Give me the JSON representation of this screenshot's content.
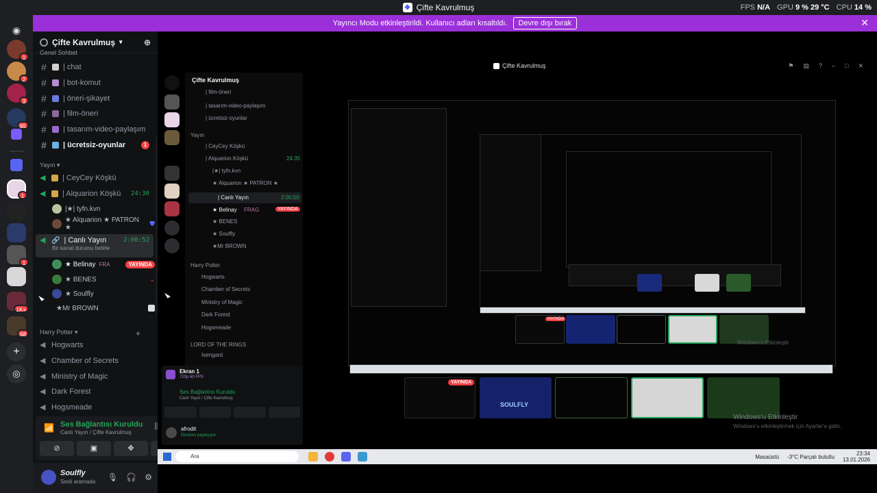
{
  "window": {
    "title": "Çifte Kavrulmuş",
    "hud": {
      "fps_label": "FPS",
      "fps_value": "N/A",
      "gpu_label": "GPU",
      "gpu_value": "9 %",
      "gpu_temp": "29 °C",
      "cpu_label": "CPU",
      "cpu_value": "14 %"
    }
  },
  "banner": {
    "text": "Yayıncı Modu etkinleştirildi. Kullanıcı adları kısaltıldı.",
    "button": "Devre dışı bırak",
    "close": "✕"
  },
  "rail": {
    "badges": [
      "1",
      "2",
      "3",
      "85",
      "1",
      "1",
      "1K+",
      "68"
    ]
  },
  "server": {
    "name": "Çifte Kavrulmuş",
    "partial_category": "Genel Sohbet",
    "channels": [
      {
        "name": "| chat"
      },
      {
        "name": "| bot-komut"
      },
      {
        "name": "| öneri-şikayet"
      },
      {
        "name": "| film-öneri"
      },
      {
        "name": "| tasarım-video-paylaşım"
      },
      {
        "name": "| ücretsiz-oyunlar",
        "count": "1"
      }
    ],
    "voice_category": "Yayın",
    "voice_channels": [
      {
        "name": "| CeyCey Köşkü"
      },
      {
        "name": "| Alquarion Köşkü",
        "timer": "24:30"
      },
      {
        "name": "| Canlı Yayın",
        "timer": "2:00:52",
        "status": "Bir kanal durumu belirle"
      }
    ],
    "alquarion_users": [
      "|★| tyfn.kvn",
      "★ Alquarion ★ PATRON ★"
    ],
    "live_users": [
      {
        "name": "★ Belinay",
        "tag": "FRA",
        "badge": "YAYINDA"
      },
      {
        "name": "★ BENES"
      },
      {
        "name": "★ Soulfly"
      },
      {
        "name": "★Mr BROWN"
      }
    ],
    "hp_category": "Harry Potter",
    "hp_channels": [
      "Hogwarts",
      "Chamber of Secrets",
      "Ministry of Magic",
      "Dark Forest",
      "Hogsmeade"
    ]
  },
  "voice_panel": {
    "title": "Ses Bağlantısı Kuruldu",
    "subtitle": "Canlı Yayın / Çifte Kavrulmuş"
  },
  "user_bar": {
    "name": "Soulfly",
    "status": "Sesli aramada"
  },
  "stream": {
    "window_title": "Çifte Kavrulmuş",
    "inner_channels": [
      "| film-öneri",
      "| tasarım-video-paylaşım",
      "| ücretsiz-oyunlar"
    ],
    "inner_category": "Yayın",
    "inner_voice": [
      "| CeyCey Köşkü",
      "| Alquarion Köşkü"
    ],
    "inner_timer": "24:35",
    "inner_users": [
      "|★| tyfn.kvn",
      "★ Alquarion ★ PATRON ★"
    ],
    "inner_live": "| Canlı Yayın",
    "inner_live_timer": "2:00:50",
    "inner_live_users": [
      "★ Belinay",
      "★ BENES",
      "★ Soulfly",
      "★Mr BROWN"
    ],
    "inner_badge": "YAYINDA",
    "inner_frag": "FRAG",
    "inner_hp": "Harry Potter",
    "inner_hp_channels": [
      "Hogwarts",
      "Chamber of Secrets",
      "Ministry of Magic",
      "Dark Forest",
      "Hogsmeade"
    ],
    "inner_lotr": "LORD OF THE RINGS",
    "inner_lotr_channel": "Isengard",
    "screen_title": "Ekran 1",
    "screen_sub": "720p 60 FPS",
    "inner_voice_title": "Ses Bağlantısı Kuruldu",
    "inner_voice_sub": "Canlı Yayın / Çifte Kavrulmuş",
    "inner_user": "afrodit",
    "inner_user_status": "Ekranını paylaşıyor",
    "badge_live": "YAYINDA",
    "soulfly_tile": "SOULFLY",
    "watermark_title": "Windows'u Etkinleştir",
    "watermark_sub": "Windows'u etkinleştirmek için Ayarlar'a gidin.",
    "taskbar": {
      "search": "Ara",
      "desktop": "Masaüstü",
      "weather": "-3°C  Parçalı bulutlu",
      "time": "23:34",
      "date": "13.01.2026"
    }
  }
}
